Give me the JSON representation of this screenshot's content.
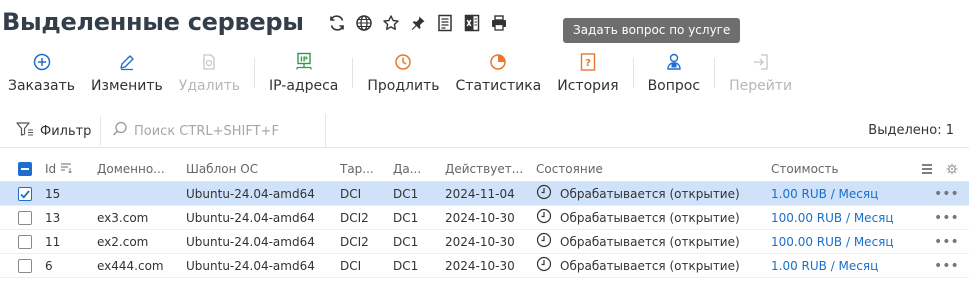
{
  "page": {
    "title": "Выделенные серверы",
    "title_icons": [
      "refresh-icon",
      "globe-icon",
      "star-icon",
      "pin-icon",
      "document-icon",
      "excel-icon",
      "print-icon"
    ]
  },
  "tooltip": {
    "text": "Задать вопрос по услуге"
  },
  "toolbar": {
    "order": {
      "label": "Заказать",
      "icon": "plus-circle-icon"
    },
    "edit": {
      "label": "Изменить",
      "icon": "pencil-icon"
    },
    "delete": {
      "label": "Удалить",
      "icon": "trash-icon"
    },
    "ip": {
      "label": "IP-адреса",
      "icon": "ip-icon"
    },
    "renew": {
      "label": "Продлить",
      "icon": "clock-icon"
    },
    "stats": {
      "label": "Статистика",
      "icon": "pie-icon"
    },
    "history": {
      "label": "История",
      "icon": "history-icon"
    },
    "question": {
      "label": "Вопрос",
      "icon": "support-icon"
    },
    "goto": {
      "label": "Перейти",
      "icon": "enter-icon"
    }
  },
  "filter": {
    "label": "Фильтр",
    "search_placeholder": "Поиск CTRL+SHIFT+F",
    "selected": "Выделено: 1"
  },
  "table": {
    "columns": {
      "id": "Id",
      "domain": "Доменно...",
      "template": "Шаблон ОС",
      "tariff": "Тар...",
      "dc": "Да...",
      "valid_until": "Действует...",
      "state": "Состояние",
      "cost": "Стоимость"
    },
    "rows": [
      {
        "id": "15",
        "domain": "",
        "template": "Ubuntu-24.04-amd64",
        "tariff": "DCI",
        "dc": "DC1",
        "valid_until": "2024-11-04",
        "state": "Обрабатывается (открытие)",
        "cost": "1.00 RUB / Месяц",
        "selected": true
      },
      {
        "id": "13",
        "domain": "ex3.com",
        "template": "Ubuntu-24.04-amd64",
        "tariff": "DCI2",
        "dc": "DC1",
        "valid_until": "2024-10-30",
        "state": "Обрабатывается (открытие)",
        "cost": "100.00 RUB / Месяц",
        "selected": false
      },
      {
        "id": "11",
        "domain": "ex2.com",
        "template": "Ubuntu-24.04-amd64",
        "tariff": "DCI2",
        "dc": "DC1",
        "valid_until": "2024-10-30",
        "state": "Обрабатывается (открытие)",
        "cost": "100.00 RUB / Месяц",
        "selected": false
      },
      {
        "id": "6",
        "domain": "ex444.com",
        "template": "Ubuntu-24.04-amd64",
        "tariff": "DCI",
        "dc": "DC1",
        "valid_until": "2024-10-30",
        "state": "Обрабатывается (открытие)",
        "cost": "1.00 RUB / Месяц",
        "selected": false
      }
    ],
    "row_menu": "•••"
  },
  "colors": {
    "accent_blue": "#1e6ecf",
    "ip_green": "#2e9a45",
    "renew_orange": "#e8772e",
    "selected_row": "#cfe2fa",
    "title_text": "#343e4b"
  }
}
